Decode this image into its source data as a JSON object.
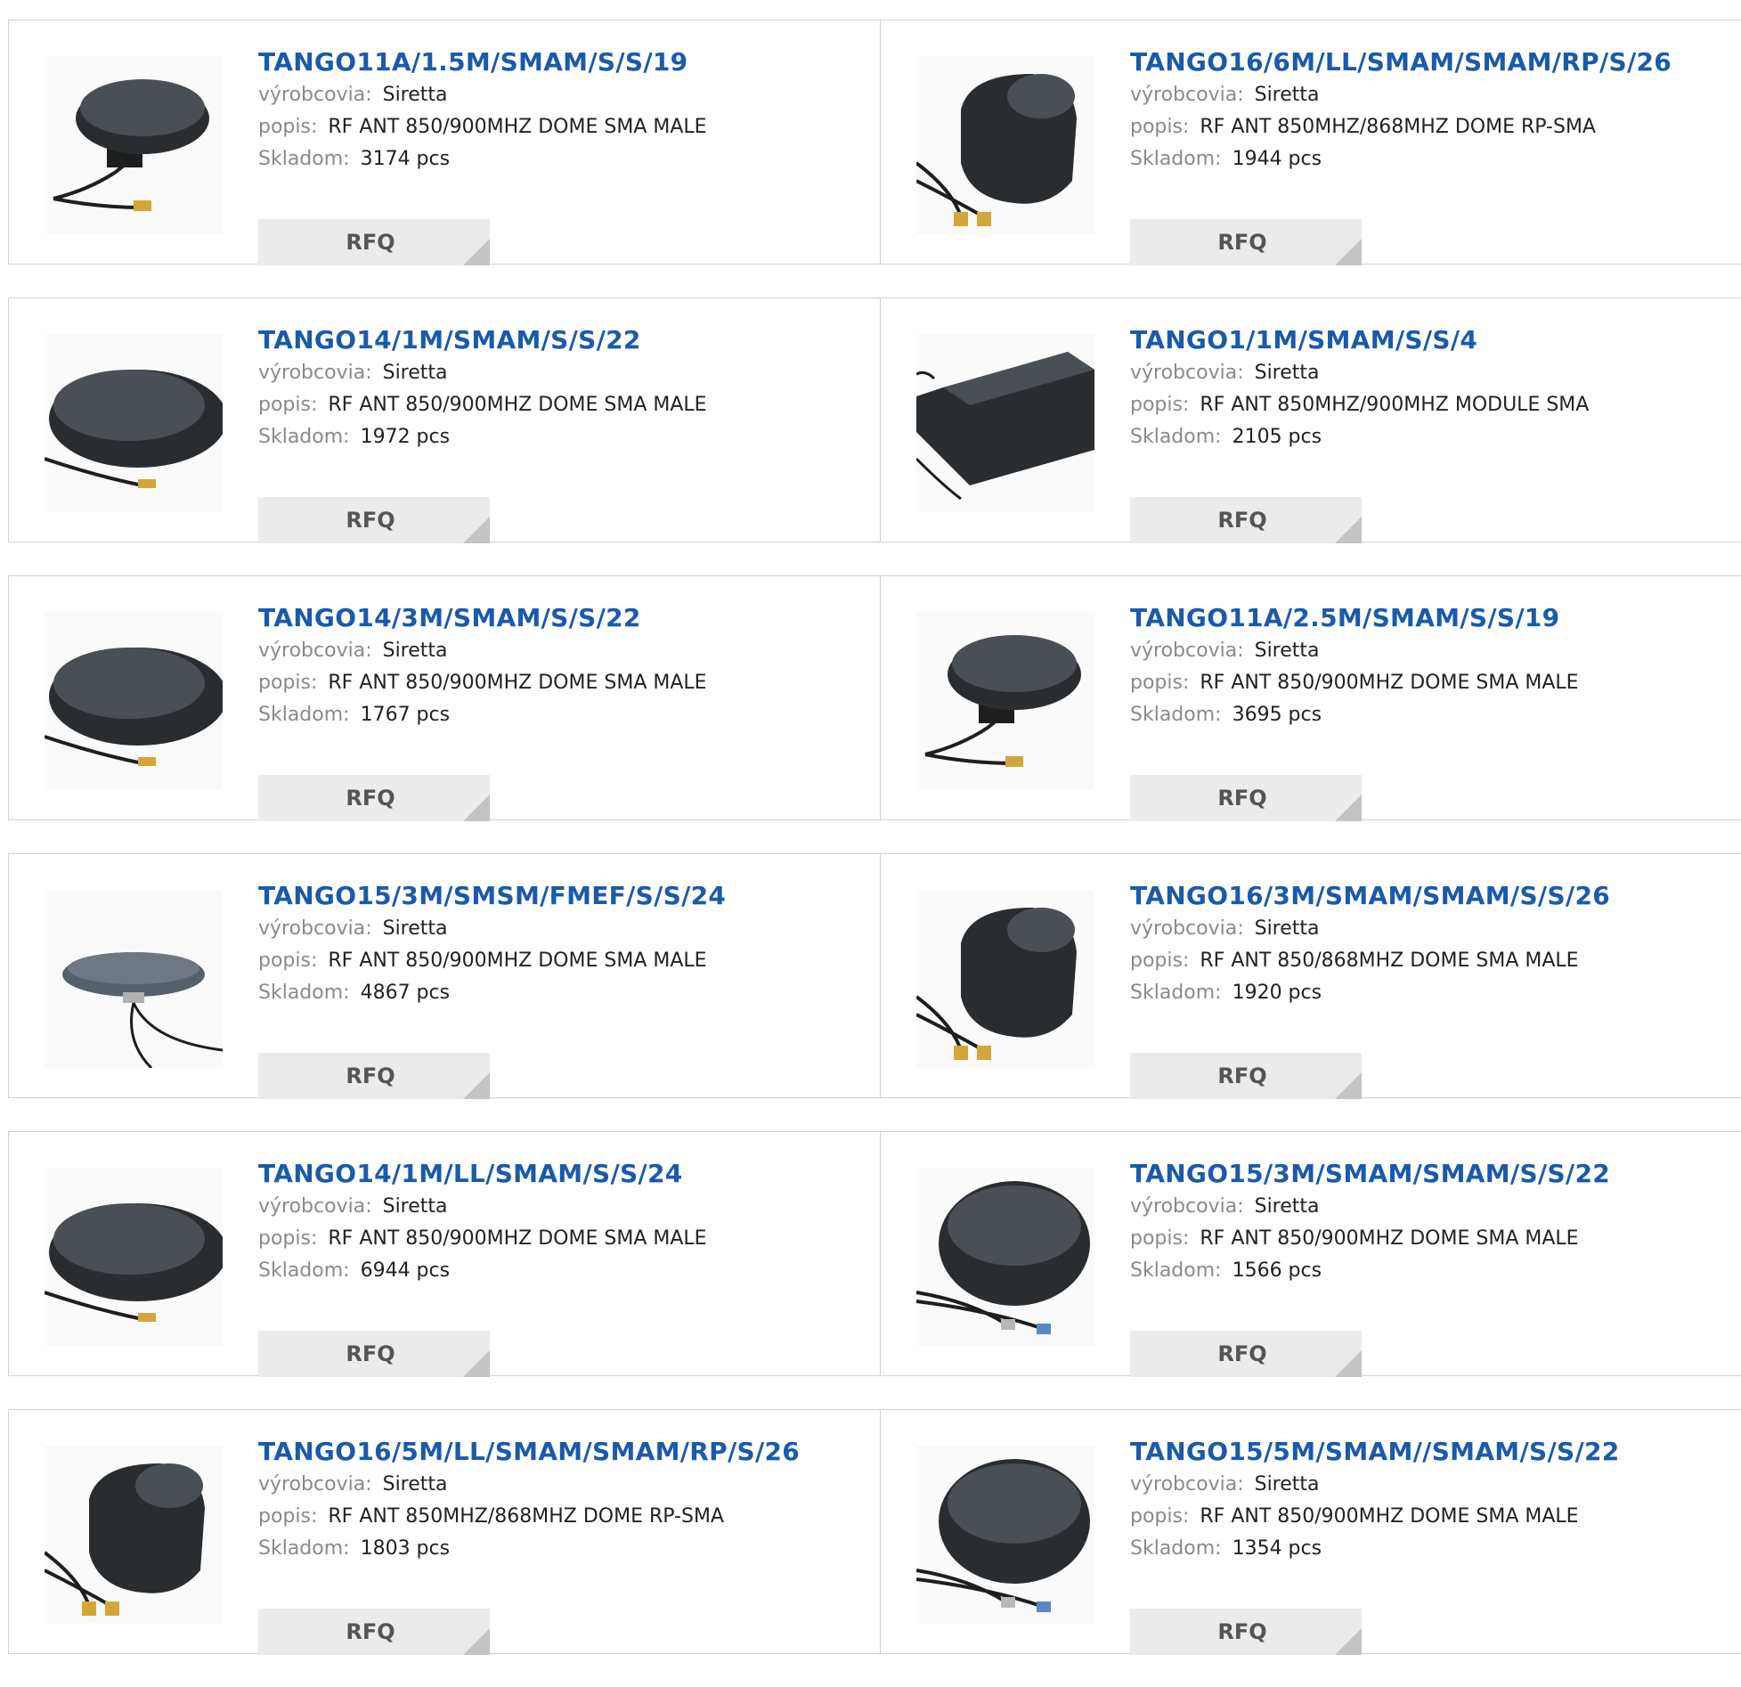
{
  "labels": {
    "manufacturer": "výrobcovia:",
    "description": "popis:",
    "stock": "Skladom:",
    "rfq": "RFQ"
  },
  "products": [
    {
      "pn": "TANGO11A/1.5M/SMAM/S/S/19",
      "manufacturer": "Siretta",
      "description": "RF ANT 850/900MHZ DOME SMA MALE",
      "stock": "3174 pcs",
      "image": "antenna-dome-round-icon"
    },
    {
      "pn": "TANGO16/6M/LL/SMAM/SMAM/RP/S/26",
      "manufacturer": "Siretta",
      "description": "RF ANT 850MHZ/868MHZ DOME RP-SMA",
      "stock": "1944 pcs",
      "image": "antenna-dome-tall-icon"
    },
    {
      "pn": "TANGO14/1M/SMAM/S/S/22",
      "manufacturer": "Siretta",
      "description": "RF ANT 850/900MHZ DOME SMA MALE",
      "stock": "1972 pcs",
      "image": "antenna-dome-flat-icon"
    },
    {
      "pn": "TANGO1/1M/SMAM/S/S/4",
      "manufacturer": "Siretta",
      "description": "RF ANT 850MHZ/900MHZ MODULE SMA",
      "stock": "2105 pcs",
      "image": "antenna-module-icon"
    },
    {
      "pn": "TANGO14/3M/SMAM/S/S/22",
      "manufacturer": "Siretta",
      "description": "RF ANT 850/900MHZ DOME SMA MALE",
      "stock": "1767 pcs",
      "image": "antenna-dome-flat-icon"
    },
    {
      "pn": "TANGO11A/2.5M/SMAM/S/S/19",
      "manufacturer": "Siretta",
      "description": "RF ANT 850/900MHZ DOME SMA MALE",
      "stock": "3695 pcs",
      "image": "antenna-dome-round-icon"
    },
    {
      "pn": "TANGO15/3M/SMSM/FMEF/S/S/24",
      "manufacturer": "Siretta",
      "description": "RF ANT 850/900MHZ DOME SMA MALE",
      "stock": "4867 pcs",
      "image": "antenna-dome-small-icon"
    },
    {
      "pn": "TANGO16/3M/SMAM/SMAM/S/S/26",
      "manufacturer": "Siretta",
      "description": "RF ANT 850/868MHZ DOME SMA MALE",
      "stock": "1920 pcs",
      "image": "antenna-dome-tall-icon"
    },
    {
      "pn": "TANGO14/1M/LL/SMAM/S/S/24",
      "manufacturer": "Siretta",
      "description": "RF ANT 850/900MHZ DOME SMA MALE",
      "stock": "6944 pcs",
      "image": "antenna-dome-flat-icon"
    },
    {
      "pn": "TANGO15/3M/SMAM/SMAM/S/S/22",
      "manufacturer": "Siretta",
      "description": "RF ANT 850/900MHZ DOME SMA MALE",
      "stock": "1566 pcs",
      "image": "antenna-dome-wide-icon"
    },
    {
      "pn": "TANGO16/5M/LL/SMAM/SMAM/RP/S/26",
      "manufacturer": "Siretta",
      "description": "RF ANT 850MHZ/868MHZ DOME RP-SMA",
      "stock": "1803 pcs",
      "image": "antenna-dome-tall-icon"
    },
    {
      "pn": "TANGO15/5M/SMAM//SMAM/S/S/22",
      "manufacturer": "Siretta",
      "description": "RF ANT 850/900MHZ DOME SMA MALE",
      "stock": "1354 pcs",
      "image": "antenna-dome-wide-icon"
    }
  ]
}
